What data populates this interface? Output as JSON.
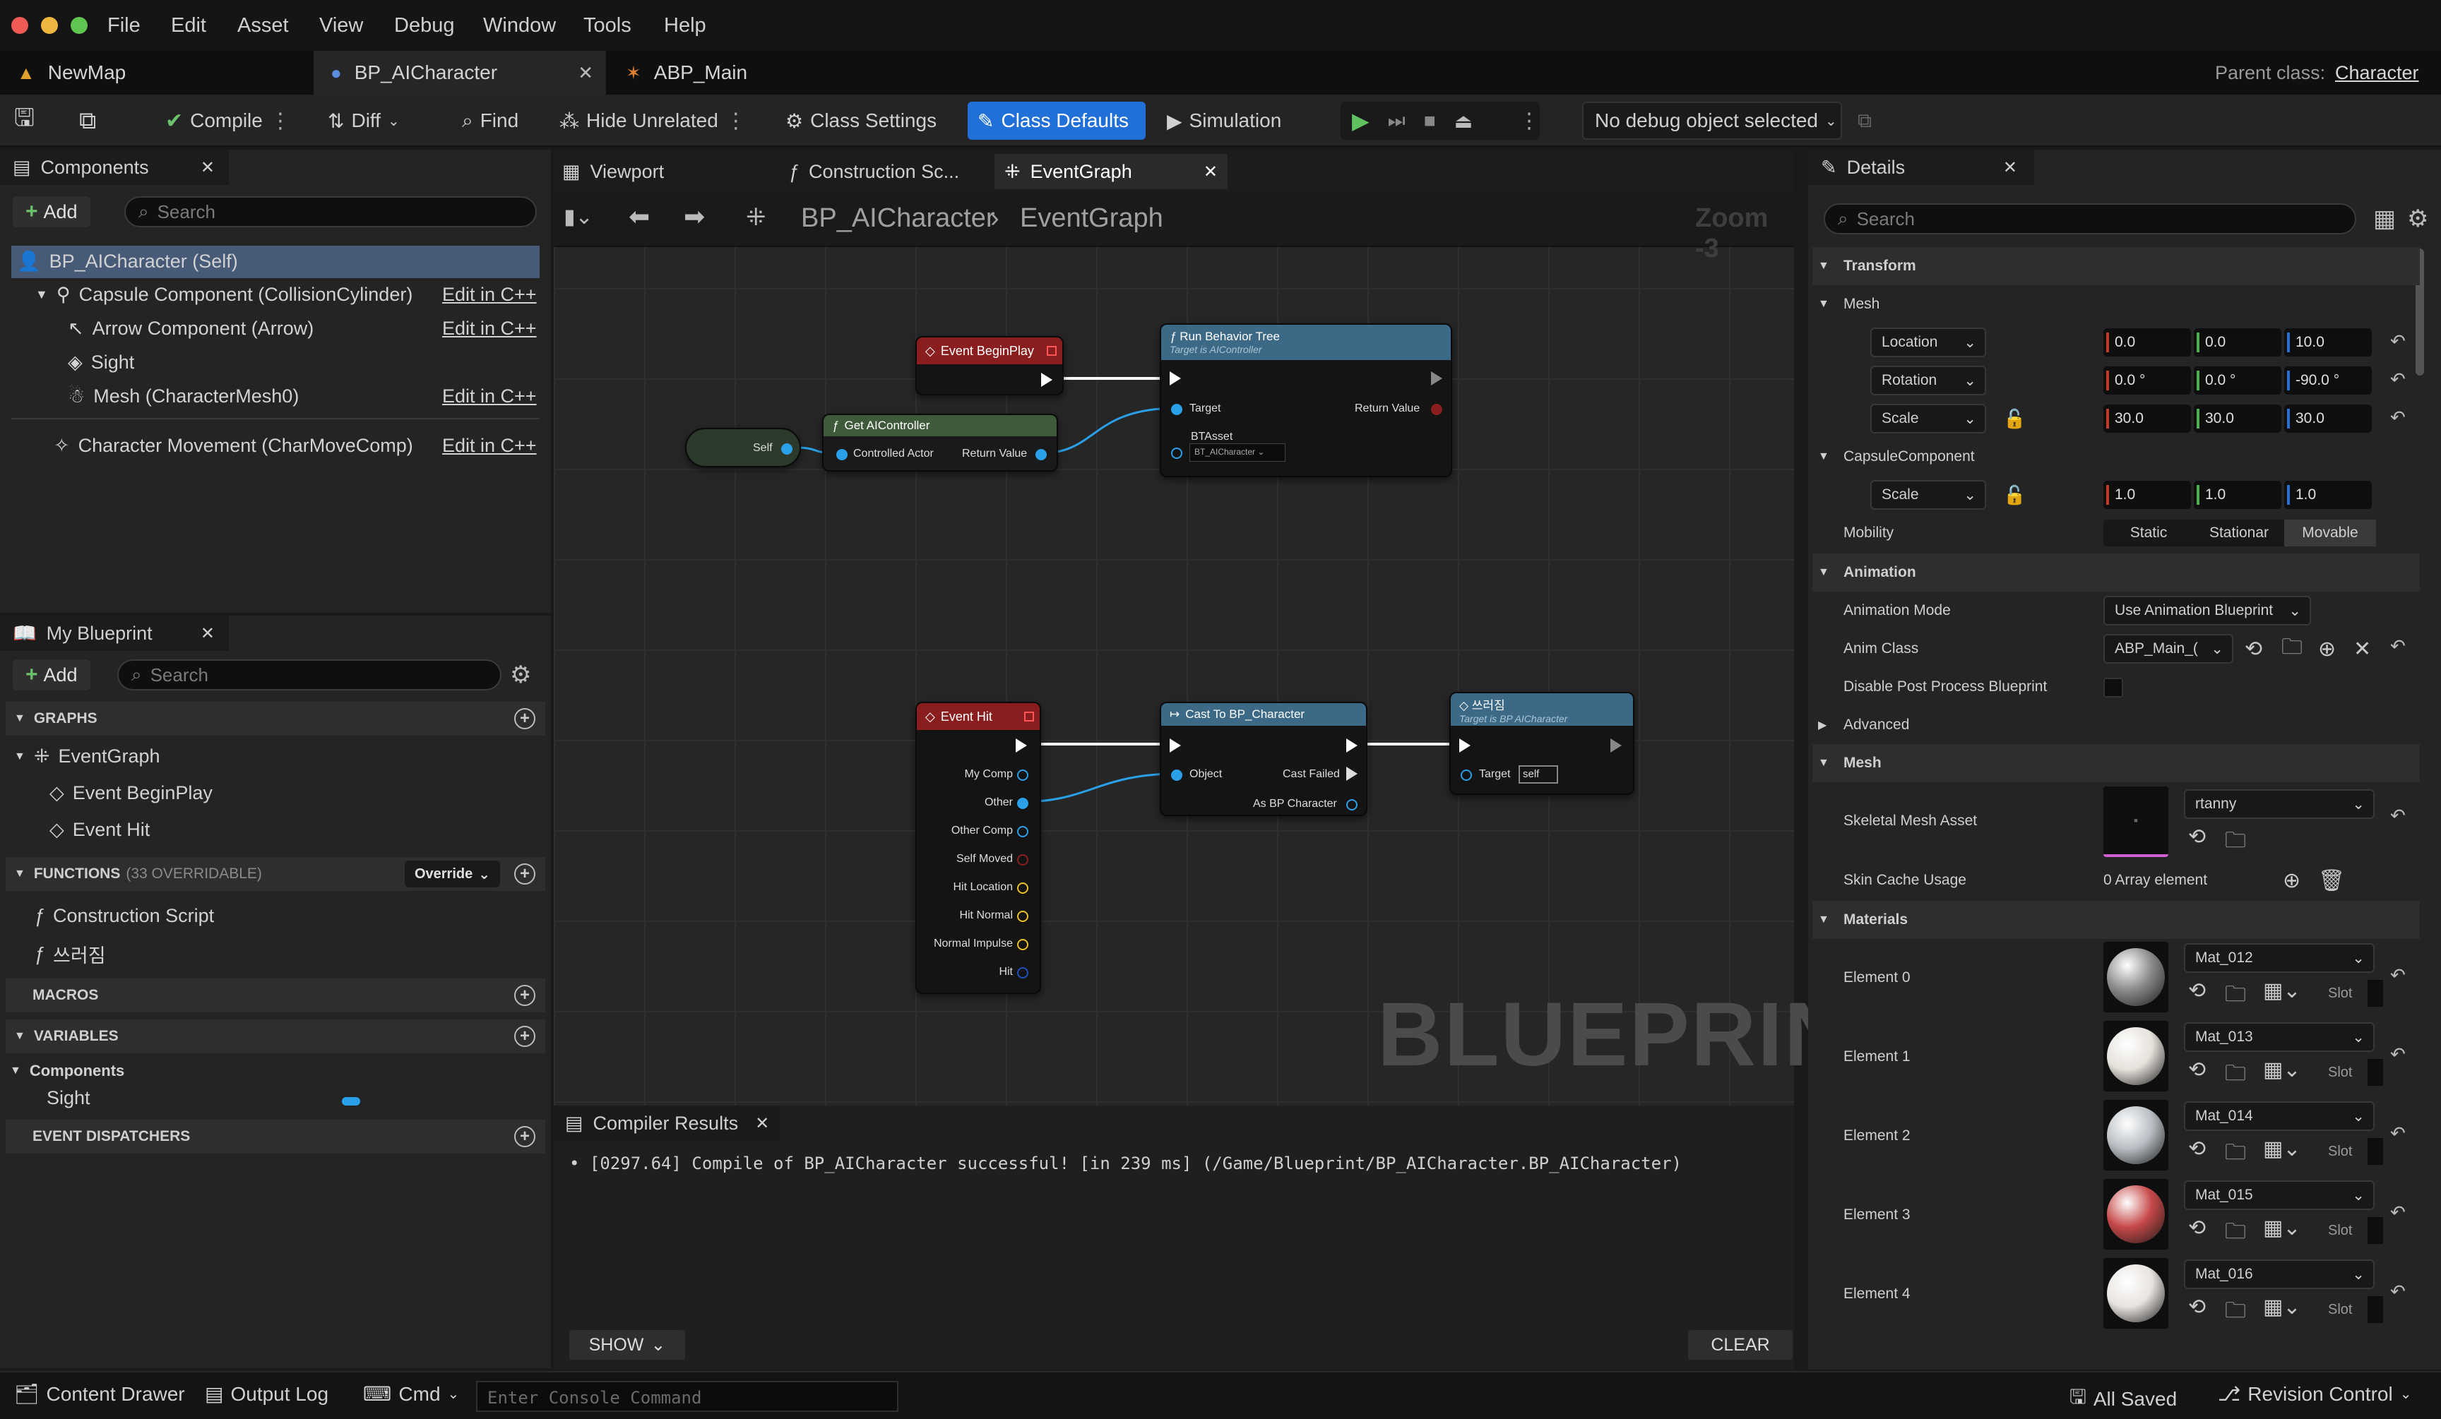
{
  "menu": [
    "File",
    "Edit",
    "Asset",
    "View",
    "Debug",
    "Window",
    "Tools",
    "Help"
  ],
  "tabs": {
    "new_map": "NewMap",
    "bp_ai": "BP_AICharacter",
    "abp_main": "ABP_Main",
    "parent_label": "Parent class:",
    "parent_value": "Character"
  },
  "toolbar": {
    "compile": "Compile",
    "diff": "Diff",
    "find": "Find",
    "hide_unrelated": "Hide Unrelated",
    "class_settings": "Class Settings",
    "class_defaults": "Class Defaults",
    "simulation": "Simulation",
    "debug_object": "No debug object selected"
  },
  "components_panel": {
    "title": "Components",
    "add": "Add",
    "search_placeholder": "Search",
    "items": [
      {
        "label": "BP_AICharacter (Self)"
      },
      {
        "label": "Capsule Component (CollisionCylinder)",
        "edit": "Edit in C++"
      },
      {
        "label": "Arrow Component (Arrow)",
        "edit": "Edit in C++"
      },
      {
        "label": "Sight"
      },
      {
        "label": "Mesh (CharacterMesh0)",
        "edit": "Edit in C++"
      },
      {
        "label": "Character Movement (CharMoveComp)",
        "edit": "Edit in C++"
      }
    ]
  },
  "my_blueprint": {
    "title": "My Blueprint",
    "add": "Add",
    "search_placeholder": "Search",
    "graphs_header": "GRAPHS",
    "graphs": [
      "EventGraph",
      "Event BeginPlay",
      "Event Hit"
    ],
    "functions_header": "FUNCTIONS",
    "functions_count": "(33 OVERRIDABLE)",
    "override": "Override",
    "functions": [
      "Construction Script",
      "쓰러짐"
    ],
    "macros_header": "MACROS",
    "variables_header": "VARIABLES",
    "variables_group": "Components",
    "variables": [
      "Sight"
    ],
    "dispatchers_header": "EVENT DISPATCHERS"
  },
  "graph_tabs": {
    "viewport": "Viewport",
    "construction": "Construction Sc...",
    "eventgraph": "EventGraph"
  },
  "graph": {
    "breadcrumb_root": "BP_AICharacter",
    "breadcrumb_leaf": "EventGraph",
    "zoom": "Zoom -3",
    "watermark": "BLUEPRINT",
    "nodes": {
      "begin_play": "Event BeginPlay",
      "get_ai": "Get AIController",
      "get_ai_in": "Controlled Actor",
      "get_ai_out": "Return Value",
      "self": "Self",
      "run_bt": "Run Behavior Tree",
      "run_bt_sub": "Target is AIController",
      "run_bt_target": "Target",
      "run_bt_return": "Return Value",
      "run_bt_asset": "BTAsset",
      "run_bt_asset_val": "BT_AICharacter",
      "event_hit": "Event Hit",
      "hit_pins": [
        "My Comp",
        "Other",
        "Other Comp",
        "Self Moved",
        "Hit Location",
        "Hit Normal",
        "Normal Impulse",
        "Hit"
      ],
      "cast": "Cast To BP_Character",
      "cast_object": "Object",
      "cast_failed": "Cast Failed",
      "cast_as": "As BP Character",
      "fall": "쓰러짐",
      "fall_sub": "Target is BP AICharacter",
      "fall_target": "Target",
      "fall_target_val": "self"
    }
  },
  "compiler": {
    "title": "Compiler Results",
    "message": "[0297.64] Compile of BP_AICharacter successful! [in 239 ms] (/Game/Blueprint/BP_AICharacter.BP_AICharacter)",
    "show": "SHOW",
    "clear": "CLEAR"
  },
  "details": {
    "title": "Details",
    "search_placeholder": "Search",
    "transform": "Transform",
    "mesh_group": "Mesh",
    "location": "Location",
    "rotation": "Rotation",
    "scale": "Scale",
    "loc": [
      "0.0",
      "0.0",
      "10.0"
    ],
    "rot": [
      "0.0 °",
      "0.0 °",
      "-90.0 °"
    ],
    "scl": [
      "30.0",
      "30.0",
      "30.0"
    ],
    "capsule": "CapsuleComponent",
    "cap_scale": [
      "1.0",
      "1.0",
      "1.0"
    ],
    "mobility": "Mobility",
    "mobility_opts": [
      "Static",
      "Stationar",
      "Movable"
    ],
    "animation": "Animation",
    "anim_mode": "Animation Mode",
    "anim_mode_val": "Use Animation Blueprint",
    "anim_class": "Anim Class",
    "anim_class_val": "ABP_Main_(",
    "disable_pp": "Disable Post Process Blueprint",
    "advanced": "Advanced",
    "mesh": "Mesh",
    "skeletal": "Skeletal Mesh Asset",
    "skeletal_val": "rtanny",
    "skin_cache": "Skin Cache Usage",
    "skin_cache_val": "0 Array element",
    "materials": "Materials",
    "slot": "Slot",
    "elements": [
      {
        "label": "Element 0",
        "mat": "Mat_012",
        "color": "#8a8a8a"
      },
      {
        "label": "Element 1",
        "mat": "Mat_013",
        "color": "#e6e2dc"
      },
      {
        "label": "Element 2",
        "mat": "Mat_014",
        "color": "#b9bfc4"
      },
      {
        "label": "Element 3",
        "mat": "Mat_015",
        "color": "#c64848"
      },
      {
        "label": "Element 4",
        "mat": "Mat_016",
        "color": "#e8e4e0"
      }
    ]
  },
  "statusbar": {
    "content_drawer": "Content Drawer",
    "output_log": "Output Log",
    "cmd": "Cmd",
    "console_placeholder": "Enter Console Command",
    "all_saved": "All Saved",
    "revision": "Revision Control"
  },
  "colors": {
    "accent": "#2070d8",
    "event_red": "#8a1e1e",
    "function_blue": "#3c6a86",
    "pure_green": "#3f5a3a",
    "pin_blue": "#2aa0e8"
  }
}
